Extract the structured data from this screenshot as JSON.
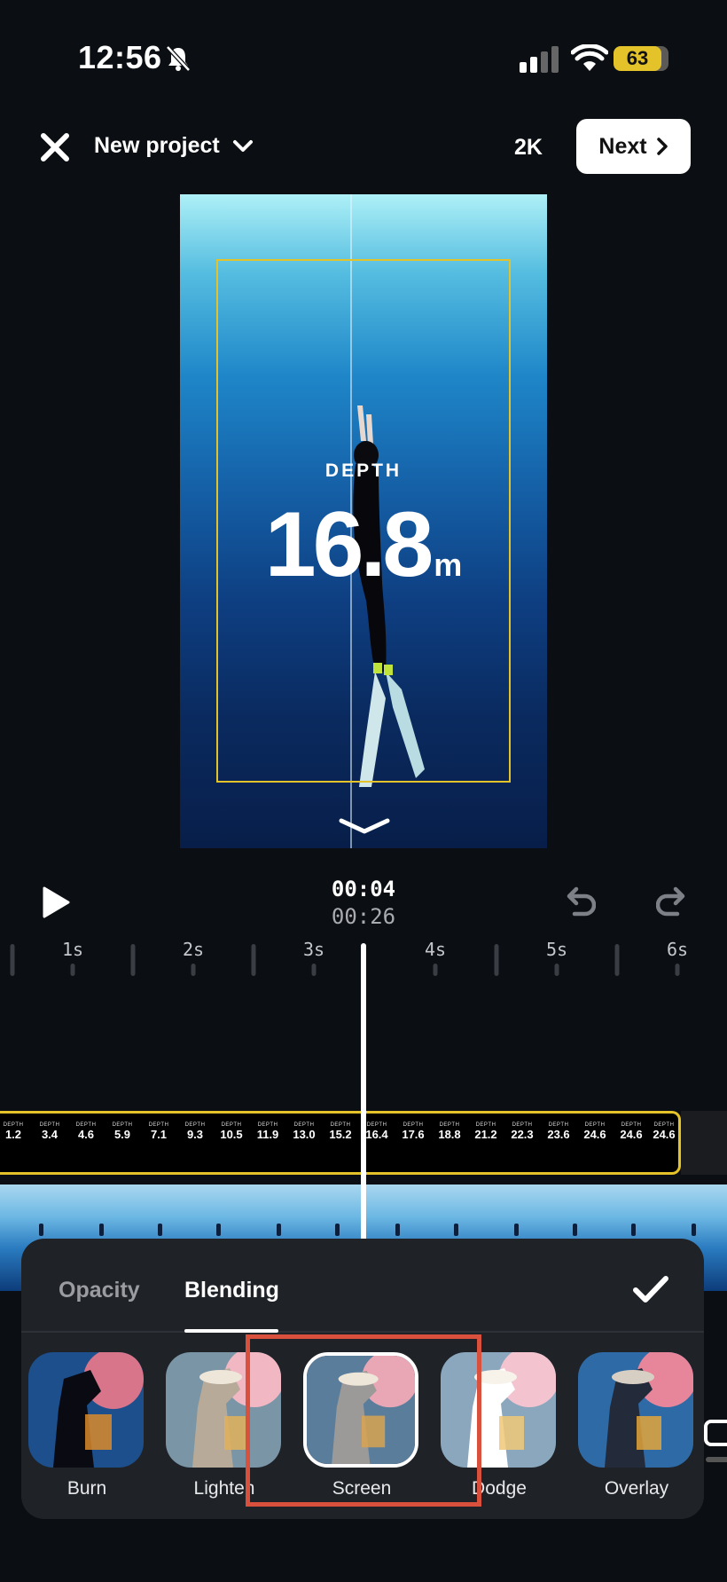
{
  "status": {
    "time": "12:56",
    "battery": "63"
  },
  "topbar": {
    "project_title": "New project",
    "resolution": "2K",
    "next_label": "Next"
  },
  "preview": {
    "depth_label": "DEPTH",
    "depth_value": "16.8",
    "depth_unit": "m"
  },
  "playback": {
    "current_time": "00:04",
    "total_time": "00:26"
  },
  "ruler": {
    "labels": [
      "1s",
      "2s",
      "3s",
      "4s",
      "5s",
      "6s"
    ]
  },
  "overlay_track": {
    "values": [
      "1.2",
      "3.4",
      "4.6",
      "5.9",
      "7.1",
      "9.3",
      "10.5",
      "11.9",
      "13.0",
      "15.2",
      "16.4",
      "17.6",
      "18.8",
      "21.2",
      "22.3",
      "23.6",
      "24.6",
      "24.6",
      "24.6"
    ]
  },
  "sheet": {
    "tabs": [
      {
        "label": "Opacity"
      },
      {
        "label": "Blending"
      }
    ],
    "active_tab": "Blending",
    "blend_modes": [
      {
        "label": "Burn"
      },
      {
        "label": "Lighten"
      },
      {
        "label": "Screen"
      },
      {
        "label": "Dodge"
      },
      {
        "label": "Overlay"
      }
    ],
    "selected_mode": "Screen"
  },
  "colors": {
    "accent_yellow": "#e3c22a",
    "highlight_red": "#d9513c",
    "background": "#0b0e12",
    "sheet": "#1f2227"
  }
}
